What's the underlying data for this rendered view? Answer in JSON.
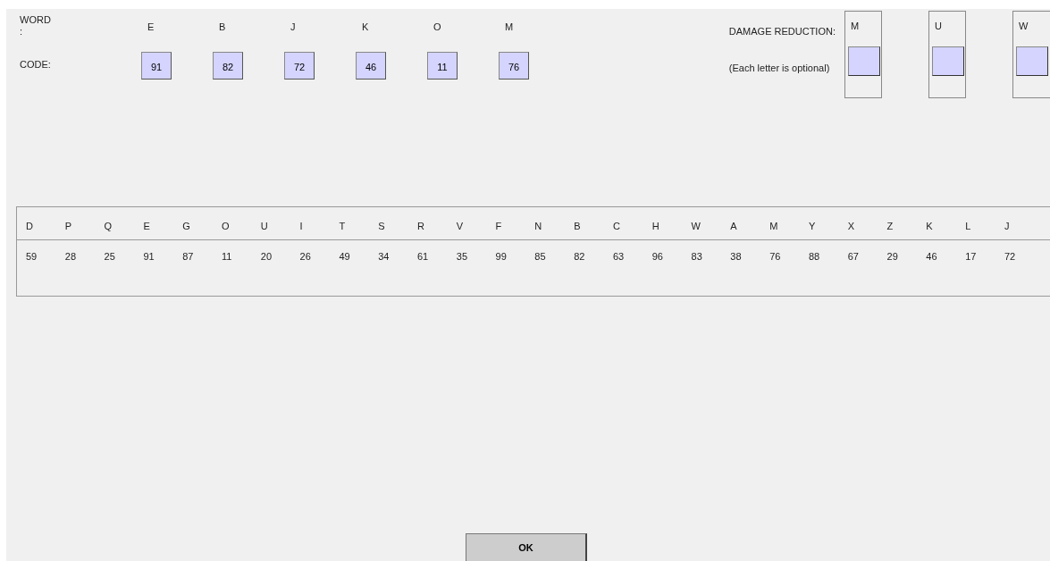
{
  "word_label": "WORD",
  "word_colon": ":",
  "code_label": "CODE:",
  "word": [
    {
      "letter": "E",
      "code": "91"
    },
    {
      "letter": "B",
      "code": "82"
    },
    {
      "letter": "J",
      "code": "72"
    },
    {
      "letter": "K",
      "code": "46"
    },
    {
      "letter": "O",
      "code": "11"
    },
    {
      "letter": "M",
      "code": "76"
    }
  ],
  "damage_reduction": {
    "label": "DAMAGE REDUCTION:",
    "note": "(Each letter is optional)",
    "letters": [
      {
        "letter": "M"
      },
      {
        "letter": "U"
      },
      {
        "letter": "W"
      }
    ]
  },
  "code_table": [
    {
      "letter": "D",
      "code": "59"
    },
    {
      "letter": "P",
      "code": "28"
    },
    {
      "letter": "Q",
      "code": "25"
    },
    {
      "letter": "E",
      "code": "91"
    },
    {
      "letter": "G",
      "code": "87"
    },
    {
      "letter": "O",
      "code": "11"
    },
    {
      "letter": "U",
      "code": "20"
    },
    {
      "letter": "I",
      "code": "26"
    },
    {
      "letter": "T",
      "code": "49"
    },
    {
      "letter": "S",
      "code": "34"
    },
    {
      "letter": "R",
      "code": "61"
    },
    {
      "letter": "V",
      "code": "35"
    },
    {
      "letter": "F",
      "code": "99"
    },
    {
      "letter": "N",
      "code": "85"
    },
    {
      "letter": "B",
      "code": "82"
    },
    {
      "letter": "C",
      "code": "63"
    },
    {
      "letter": "H",
      "code": "96"
    },
    {
      "letter": "W",
      "code": "83"
    },
    {
      "letter": "A",
      "code": "38"
    },
    {
      "letter": "M",
      "code": "76"
    },
    {
      "letter": "Y",
      "code": "88"
    },
    {
      "letter": "X",
      "code": "67"
    },
    {
      "letter": "Z",
      "code": "29"
    },
    {
      "letter": "K",
      "code": "46"
    },
    {
      "letter": "L",
      "code": "17"
    },
    {
      "letter": "J",
      "code": "72"
    }
  ],
  "button": "OK"
}
